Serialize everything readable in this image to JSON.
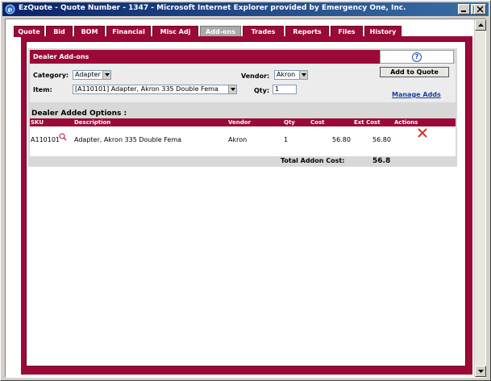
{
  "window": {
    "title": "EzQuote - Quote Number - 1347 - Microsoft Internet Explorer provided by Emergency One, Inc."
  },
  "tabs": [
    {
      "label": "Quote"
    },
    {
      "label": "Bid"
    },
    {
      "label": "BOM"
    },
    {
      "label": "Financial"
    },
    {
      "label": "Misc Adj"
    },
    {
      "label": "Add-ons"
    },
    {
      "label": "Trades"
    },
    {
      "label": "Reports"
    },
    {
      "label": "Files"
    },
    {
      "label": "History"
    }
  ],
  "active_tab": "Add-ons",
  "panel": {
    "title": "Dealer Add-ons",
    "help_glyph": "?"
  },
  "form": {
    "category_label": "Category:",
    "category_value": "Adapter",
    "vendor_label": "Vendor:",
    "vendor_value": "Akron",
    "item_label": "Item:",
    "item_value": "[A110101] Adapter, Akron 335 Double Fema",
    "qty_label": "Qty:",
    "qty_value": "1",
    "add_button": "Add to Quote",
    "manage_link": "Manage Adds"
  },
  "options": {
    "title": "Dealer Added Options :",
    "columns": {
      "sku": "SKU",
      "description": "Description",
      "vendor": "Vendor",
      "qty": "Qty",
      "cost": "Cost",
      "ext_cost": "Ext Cost",
      "actions": "Actions"
    },
    "rows": [
      {
        "sku": "A110101",
        "description": "Adapter, Akron 335 Double Fema",
        "vendor": "Akron",
        "qty": "1",
        "cost": "56.80",
        "ext_cost": "56.80"
      }
    ],
    "total_label": "Total Addon Cost:",
    "total_value": "56.8"
  },
  "colors": {
    "brand": "#9b0a36",
    "panel_bg": "#d8d8d8",
    "title_bar": "#0a246a",
    "delete_x": "#d9331c"
  },
  "icons": {
    "window": "ie-icon",
    "help": "help-icon",
    "sku_lookup": "magnifier-icon",
    "delete": "delete-x-icon"
  }
}
